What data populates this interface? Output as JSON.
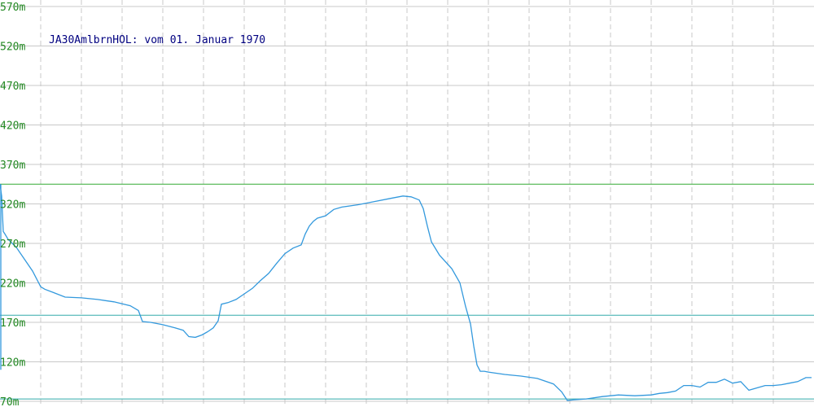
{
  "chart_data": {
    "type": "line",
    "title": "JA30AmlbrnHOL: vom 01. Januar 1970",
    "xlabel": "",
    "ylabel": "",
    "ylim": [
      70,
      570
    ],
    "xlim": [
      0,
      1000
    ],
    "yticks": [
      "570m",
      "520m",
      "470m",
      "420m",
      "370m",
      "320m",
      "270m",
      "220m",
      "170m",
      "120m",
      "70m"
    ],
    "ytick_values": [
      570,
      520,
      470,
      420,
      370,
      320,
      270,
      220,
      170,
      120,
      70
    ],
    "grid": true,
    "reference_lines": [
      {
        "value": 345,
        "color": "#33aa33"
      },
      {
        "value": 179,
        "color": "#33aaaa"
      },
      {
        "value": 73,
        "color": "#33aaaa"
      }
    ],
    "series": [
      {
        "color": "#3399dd",
        "x": [
          0,
          2,
          4,
          6,
          10,
          20,
          30,
          40,
          50,
          55,
          65,
          80,
          100,
          110,
          120,
          140,
          160,
          170,
          175,
          185,
          200,
          215,
          225,
          232,
          240,
          248,
          255,
          262,
          268,
          272,
          280,
          290,
          300,
          310,
          320,
          330,
          340,
          350,
          360,
          370,
          375,
          380,
          385,
          390,
          400,
          410,
          420,
          440,
          460,
          480,
          495,
          505,
          515,
          520,
          525,
          530,
          540,
          555,
          565,
          572,
          578,
          582,
          586,
          590,
          595,
          600,
          620,
          640,
          660,
          680,
          690,
          697,
          705,
          720,
          740,
          760,
          780,
          800,
          810,
          820,
          830,
          840,
          850,
          860,
          870,
          880,
          890,
          900,
          910,
          920,
          930,
          940,
          950,
          960,
          970,
          980,
          990,
          997
        ],
        "values": [
          345,
          330,
          285,
          282,
          275,
          265,
          250,
          235,
          215,
          212,
          208,
          202,
          201,
          200,
          199,
          196,
          191,
          185,
          171,
          170,
          167,
          163,
          160,
          152,
          151,
          154,
          158,
          163,
          172,
          193,
          195,
          199,
          206,
          213,
          223,
          232,
          245,
          257,
          264,
          268,
          282,
          292,
          298,
          302,
          305,
          313,
          316,
          319,
          323,
          327,
          330,
          329,
          325,
          314,
          292,
          272,
          255,
          238,
          220,
          190,
          168,
          140,
          116,
          108,
          108,
          107,
          104,
          102,
          99,
          92,
          82,
          71,
          72,
          73,
          76,
          78,
          77,
          78,
          80,
          81,
          83,
          90,
          90,
          88,
          94,
          94,
          98,
          93,
          95,
          84,
          87,
          90,
          90,
          91,
          93,
          95,
          100,
          100
        ]
      }
    ]
  }
}
